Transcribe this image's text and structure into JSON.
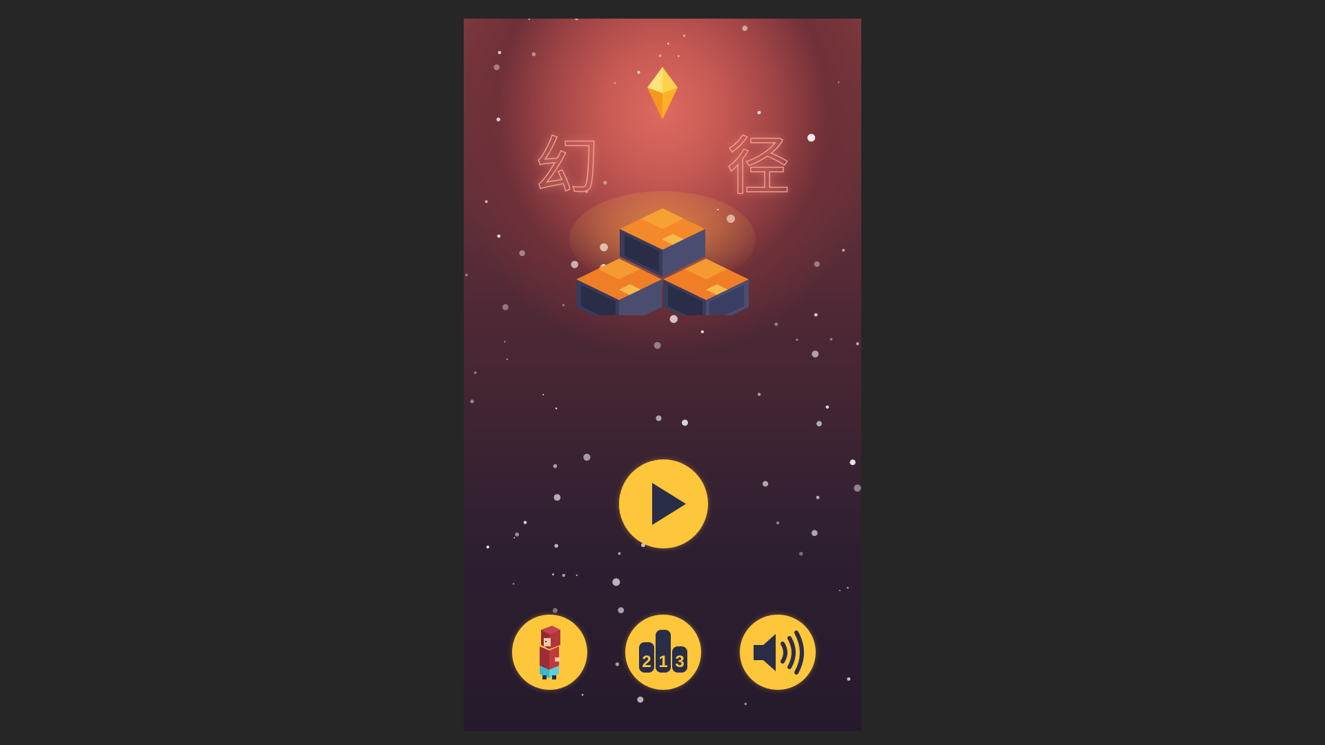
{
  "game": {
    "title": "幻 径"
  },
  "buttons": {
    "play_icon": "play-icon",
    "character_icon": "character-icon",
    "leaderboard_icon": "leaderboard-podium-icon",
    "sound_icon": "speaker-icon"
  },
  "leaderboard_digits": [
    "2",
    "1",
    "3"
  ],
  "colors": {
    "accent": "#fec63b",
    "icon_dark": "#2a2d48",
    "title": "#f59a8a"
  }
}
